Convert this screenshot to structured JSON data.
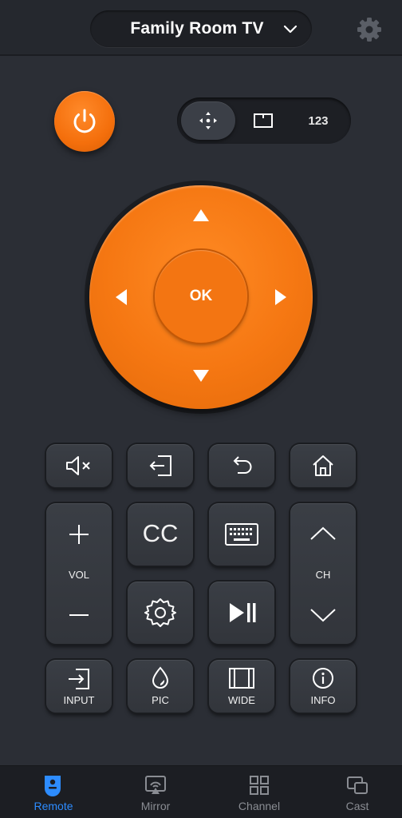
{
  "header": {
    "device_name": "Family Room TV",
    "icons": [
      "chevron-down-icon",
      "gear-icon"
    ]
  },
  "power": {
    "icon": "power-icon"
  },
  "mode_bar": {
    "dpad_icon": "dpad-icon",
    "touchpad_icon": "touchpad-icon",
    "numpad_label": "123"
  },
  "dpad": {
    "ok_label": "OK"
  },
  "keys": {
    "vol_label": "VOL",
    "ch_label": "CH",
    "cc_label": "CC",
    "input_label": "INPUT",
    "pic_label": "PIC",
    "wide_label": "WIDE",
    "info_label": "INFO"
  },
  "bottom_nav": {
    "items": [
      {
        "label": "Remote",
        "icon": "remote-icon",
        "active": true
      },
      {
        "label": "Mirror",
        "icon": "mirror-icon",
        "active": false
      },
      {
        "label": "Channel",
        "icon": "channel-grid-icon",
        "active": false
      },
      {
        "label": "Cast",
        "icon": "cast-icon",
        "active": false
      }
    ]
  },
  "colors": {
    "accent": "#f57712",
    "nav_active": "#2d8cff",
    "background": "#2b2e35"
  }
}
